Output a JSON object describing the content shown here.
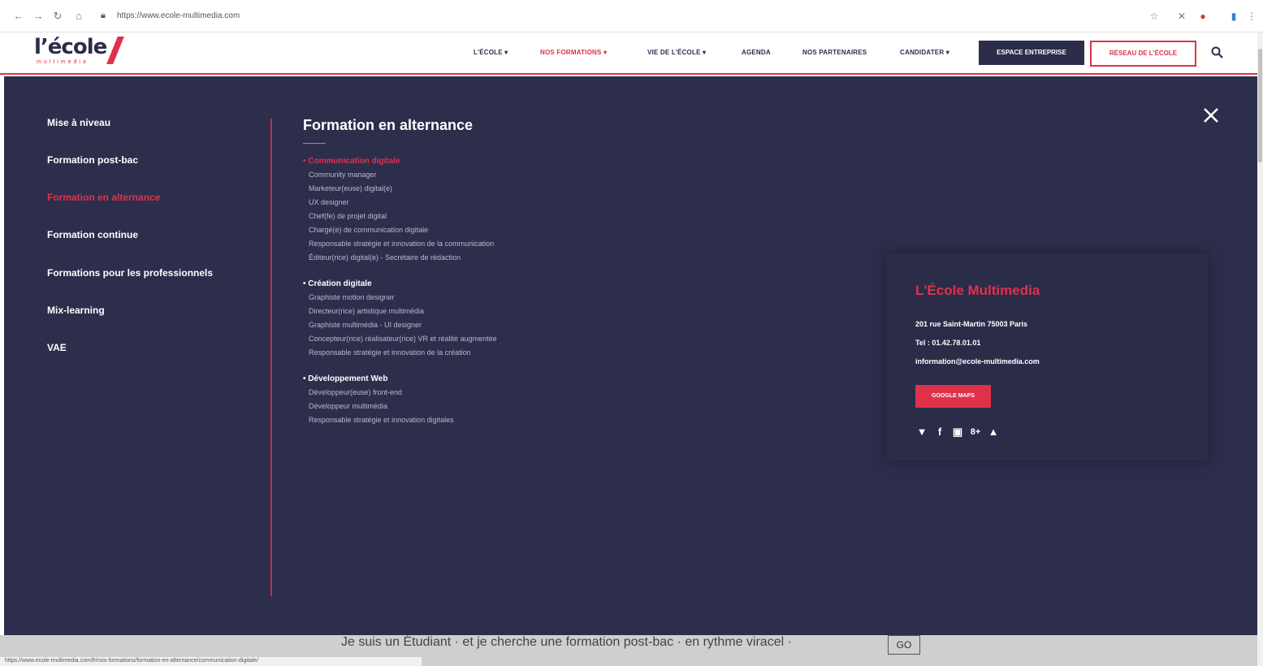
{
  "browser": {
    "url": "https://www.ecole-multimedia.com",
    "back_icon": "arrow-left-icon",
    "forward_icon": "arrow-right-icon",
    "reload_icon": "reload-icon",
    "home_icon": "home-icon"
  },
  "header": {
    "logo_text": "l’école",
    "logo_sub": "multimedia",
    "nav": [
      {
        "label": "L'ÉCOLE ▾"
      },
      {
        "label": "NOS FORMATIONS ▾"
      },
      {
        "label": "VIE DE L'ÉCOLE ▾"
      },
      {
        "label": "AGENDA"
      },
      {
        "label": "NOS PARTENAIRES"
      },
      {
        "label": "CANDIDATER ▾"
      }
    ],
    "espace_label": "ESPACE ENTREPRISE",
    "reseau_label": "RÉSEAU DE L'ÉCOLE"
  },
  "menu": {
    "left": [
      {
        "label": "Mise à niveau"
      },
      {
        "label": "Formation post-bac"
      },
      {
        "label": "Formation en alternance"
      },
      {
        "label": "Formation continue"
      },
      {
        "label": "Formations pour les professionnels"
      },
      {
        "label": "Mix-learning"
      },
      {
        "label": "VAE"
      }
    ],
    "title": "Formation en alternance",
    "groups": [
      {
        "head": "• Communication digitale",
        "items": [
          "Community manager",
          "Marketeur(euse) digital(e)",
          "UX designer",
          "Chef(fe) de projet digital",
          "Chargé(e) de communication digitale",
          "Responsable stratégie et innovation de la communication",
          "Éditeur(rice) digital(e) - Secrétaire de rédaction"
        ]
      },
      {
        "head": "• Création digitale",
        "items": [
          "Graphiste motion designer",
          "Directeur(rice) artistique multimédia",
          "Graphiste multimédia - UI designer",
          "Concepteur(rice) réalisateur(rice) VR et réalité augmentée",
          "Responsable stratégie et innovation de la création"
        ]
      },
      {
        "head": "• Développement Web",
        "items": [
          "Développeur(euse) front-end",
          "Développeur multimédia",
          "Responsable stratégie et innovation digitales"
        ]
      }
    ],
    "card": {
      "title": "L'École Multimedia",
      "address": "201 rue Saint-Martin 75003 Paris",
      "phone": "Tel : 01.42.78.01.01",
      "email": "information@ecole-multimedia.com",
      "button": "GOOGLE MAPS",
      "social": [
        "twitter-icon",
        "facebook-icon",
        "linkedin-icon",
        "google-plus-icon",
        "youtube-icon"
      ]
    }
  },
  "page_peek": {
    "sentence": "Je suis un Étudiant · et je cherche une formation post-bac · en rythme viracel ·",
    "go_label": "GO"
  },
  "status_url": "https://www.ecole-multimedia.com/fr/nos-formations/formation-en-alternance/communication-digitale/"
}
